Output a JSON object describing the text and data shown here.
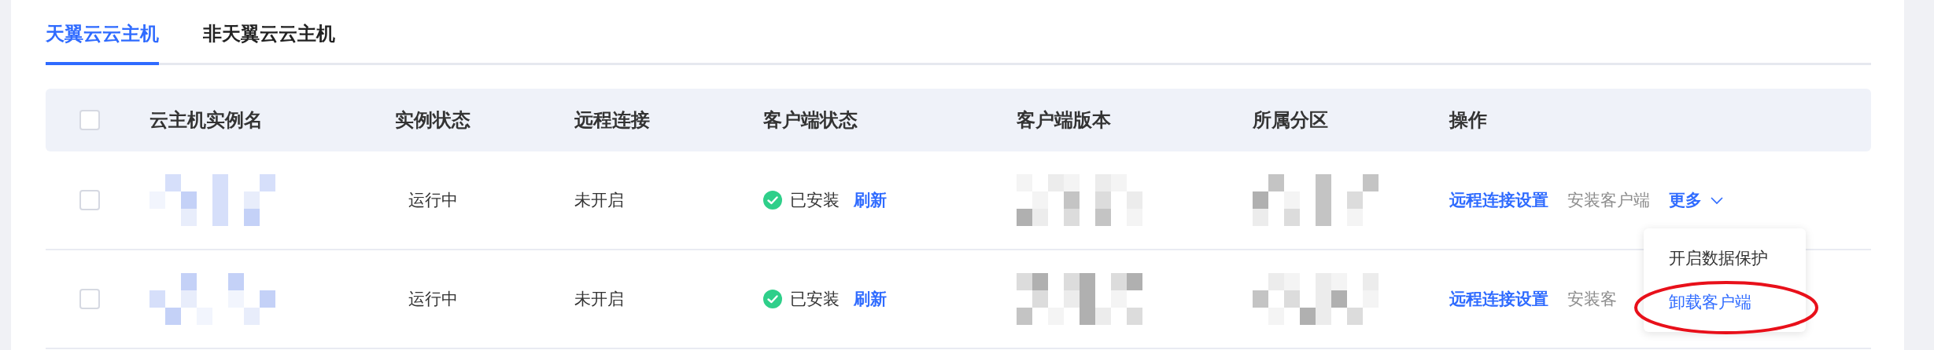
{
  "tabs": [
    {
      "label": "天翼云云主机",
      "selected": true
    },
    {
      "label": "非天翼云云主机",
      "selected": false
    }
  ],
  "table": {
    "header_checkbox": {
      "checked": false
    },
    "columns": [
      "云主机实例名",
      "实例状态",
      "远程连接",
      "客户端状态",
      "客户端版本",
      "所属分区",
      "操作"
    ],
    "rows": [
      {
        "checked": false,
        "instance_state": "运行中",
        "remote_connection": "未开启",
        "client_status": "已安装",
        "refresh": "刷新",
        "actions": [
          {
            "label": "远程连接设置",
            "kind": "link"
          },
          {
            "label": "安装客户端",
            "kind": "muted"
          },
          {
            "label": "更多",
            "kind": "more"
          }
        ]
      },
      {
        "checked": false,
        "instance_state": "运行中",
        "remote_connection": "未开启",
        "client_status": "已安装",
        "refresh": "刷新",
        "actions": [
          {
            "label": "远程连接设置",
            "kind": "link"
          },
          {
            "label": "安装客",
            "kind": "muted"
          }
        ]
      }
    ]
  },
  "dropdown": {
    "items": [
      {
        "label": "开启数据保护",
        "selected": false
      },
      {
        "label": "卸载客户端",
        "selected": true
      }
    ]
  }
}
